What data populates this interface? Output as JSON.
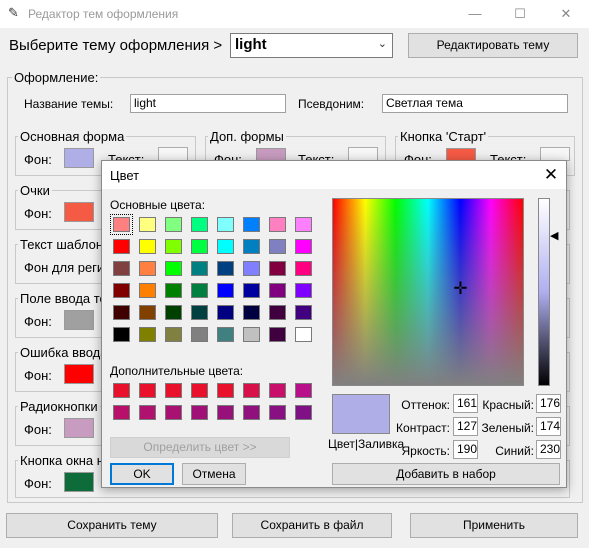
{
  "window": {
    "title": "Редактор тем оформления",
    "minimize_glyph": "—",
    "maximize_glyph": "☐",
    "close_glyph": "✕"
  },
  "header": {
    "choose_label": "Выберите тему оформления >",
    "selected_theme": "light",
    "dropdown_glyph": "⌄",
    "edit_button": "Редактировать тему"
  },
  "appearance": {
    "group_label": "Оформление:",
    "theme_name_label": "Название темы:",
    "theme_name_value": "light",
    "alias_label": "Псевдоним:",
    "alias_value": "Светлая тема"
  },
  "sections": {
    "main_form": {
      "label": "Основная форма",
      "bg_label": "Фон:",
      "text_label": "Текст:",
      "bg_color": "#b0aee6"
    },
    "extra_forms": {
      "label": "Доп. формы",
      "bg_label": "Фон:",
      "text_label": "Текст:",
      "bg_color": "#c89cc0"
    },
    "start_button": {
      "label": "Кнопка 'Старт'",
      "bg_label": "Фон:",
      "text_label": "Текст:",
      "bg_color": "#f55a44"
    },
    "glasses": {
      "label": "Очки",
      "bg_label": "Фон:",
      "bg_color": "#f55a44"
    },
    "template_text": {
      "label": "Текст шаблон",
      "bg_label": "Фон для реги"
    },
    "input_field": {
      "label": "Поле ввода те",
      "bg_label": "Фон:",
      "bg_color": "#a0a0a0"
    },
    "input_error": {
      "label": "Ошибка ввода",
      "bg_label": "Фон:",
      "bg_color": "#ff0000"
    },
    "radio_buttons": {
      "label": "Радиокнопки",
      "bg_label": "Фон:",
      "bg_color": "#c89cc0"
    },
    "window_button": {
      "label": "Кнопка окна н",
      "bg_label": "Фон:",
      "bg_color": "#0e6b3a"
    }
  },
  "footer": {
    "save_theme": "Сохранить тему",
    "save_file": "Сохранить в файл",
    "apply": "Применить"
  },
  "color_dialog": {
    "title": "Цвет",
    "close_glyph": "✕",
    "basic_colors_label": "Основные цвета:",
    "custom_colors_label": "Дополнительные цвета:",
    "basic_colors": [
      [
        "#ff8080",
        "#ffff80",
        "#80ff80",
        "#00ff80",
        "#80ffff",
        "#0080ff",
        "#ff80c0",
        "#ff80ff"
      ],
      [
        "#ff0000",
        "#ffff00",
        "#80ff00",
        "#00ff40",
        "#00ffff",
        "#0080c0",
        "#8080c0",
        "#ff00ff"
      ],
      [
        "#804040",
        "#ff8040",
        "#00ff00",
        "#008080",
        "#004080",
        "#8080ff",
        "#800040",
        "#ff0080"
      ],
      [
        "#800000",
        "#ff8000",
        "#008000",
        "#008040",
        "#0000ff",
        "#0000a0",
        "#800080",
        "#8000ff"
      ],
      [
        "#400000",
        "#804000",
        "#004000",
        "#004040",
        "#000080",
        "#000040",
        "#400040",
        "#400080"
      ],
      [
        "#000000",
        "#808000",
        "#808040",
        "#808080",
        "#408080",
        "#c0c0c0",
        "#400040",
        "#ffffff"
      ]
    ],
    "selected_basic": "0-0",
    "custom_colors": [
      [
        "#e8102a",
        "#e8102a",
        "#e8102a",
        "#e8102a",
        "#e8102a",
        "#d8104a",
        "#c8106a",
        "#b8108a"
      ],
      [
        "#b8106a",
        "#b0106e",
        "#a81072",
        "#a01076",
        "#98107a",
        "#90107e",
        "#881082",
        "#801086"
      ]
    ],
    "define_button": "Определить цвет >>",
    "ok_button": "OK",
    "cancel_button": "Отмена",
    "crosshair_glyph": "✛",
    "lum_arrow_glyph": "◀",
    "preview_color": "#b0aee6",
    "preview_label": "Цвет|Заливка",
    "hue_label": "Оттенок:",
    "hue": "161",
    "sat_label": "Контраст:",
    "sat": "127",
    "lum_label": "Яркость:",
    "lum": "190",
    "red_label": "Красный:",
    "red": "176",
    "green_label": "Зеленый:",
    "green": "174",
    "blue_label": "Синий:",
    "blue": "230",
    "add_button": "Добавить в набор"
  }
}
